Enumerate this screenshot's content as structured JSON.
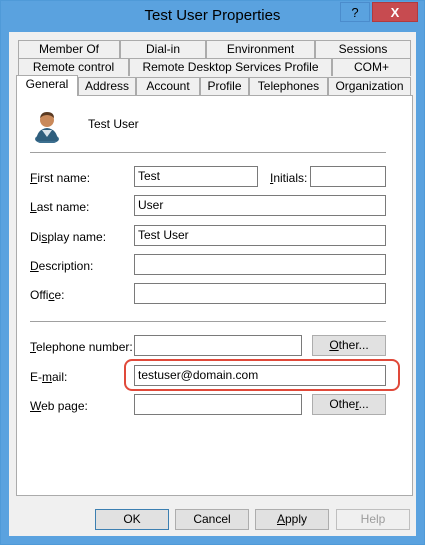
{
  "window": {
    "title": "Test User Properties",
    "help_glyph": "?",
    "close_glyph": "X"
  },
  "tabs_row1": [
    "Member Of",
    "Dial-in",
    "Environment",
    "Sessions"
  ],
  "tabs_row2": [
    "Remote control",
    "Remote Desktop Services Profile",
    "COM+"
  ],
  "tabs_row3": [
    "General",
    "Address",
    "Account",
    "Profile",
    "Telephones",
    "Organization"
  ],
  "active_tab": "General",
  "general": {
    "user_icon": "user-avatar-icon",
    "display_header": "Test User",
    "first_name": {
      "label_acc": "F",
      "label_rest": "irst name:",
      "value": "Test"
    },
    "initials": {
      "label_acc": "I",
      "label_rest": "nitials:",
      "value": ""
    },
    "last_name": {
      "label_acc": "L",
      "label_rest": "ast name:",
      "value": "User"
    },
    "display_name": {
      "label_pre": "Di",
      "label_acc": "s",
      "label_rest": "play name:",
      "value": "Test User"
    },
    "description": {
      "label_acc": "D",
      "label_rest": "escription:",
      "value": ""
    },
    "office": {
      "label_pre": "Offi",
      "label_acc": "c",
      "label_rest": "e:",
      "value": ""
    },
    "telephone": {
      "label_acc": "T",
      "label_rest": "elephone number:",
      "value": ""
    },
    "email": {
      "label_pre": "E-",
      "label_acc": "m",
      "label_rest": "ail:",
      "value": "testuser@domain.com"
    },
    "web_page": {
      "label_acc": "W",
      "label_rest": "eb page:",
      "value": ""
    },
    "other_tel": {
      "pre": "",
      "acc": "O",
      "rest": "ther..."
    },
    "other_web": {
      "pre": "Othe",
      "acc": "r",
      "rest": "..."
    }
  },
  "buttons": {
    "ok": "OK",
    "cancel": "Cancel",
    "apply_acc": "A",
    "apply_rest": "pply",
    "help": "Help"
  },
  "colors": {
    "title_bar": "#5aa2df",
    "close_button": "#c74b50",
    "highlight": "#e0493a"
  }
}
